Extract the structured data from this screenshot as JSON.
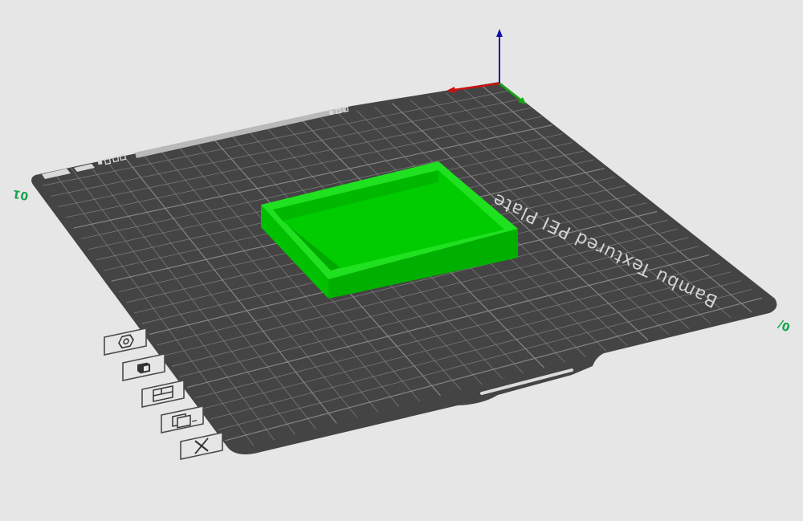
{
  "scene": {
    "background_color": "#e6e6e6",
    "plate": {
      "label": "Bambu Textured PEI Plate",
      "plate_number_left": "01",
      "plate_number_right": "0/",
      "plate_color": "#444444",
      "grid_color": "#8a8a8a",
      "label_color": "#d2d2d2"
    },
    "model": {
      "shape": "shallow-tray",
      "color": "#00cc00",
      "highlight_color": "#22e622",
      "shadow_color": "#00a000"
    },
    "axes": {
      "x_color": "#cc1111",
      "y_color": "#11aa11",
      "z_color": "#1111aa"
    }
  },
  "plate_toolbar": {
    "buttons": [
      {
        "id": "arrange",
        "icon": "hexagon-icon"
      },
      {
        "id": "orient",
        "icon": "lock-icon"
      },
      {
        "id": "layout",
        "icon": "layout-icon"
      },
      {
        "id": "settings",
        "icon": "edit-plate-icon"
      },
      {
        "id": "delete",
        "icon": "close-icon"
      }
    ]
  },
  "accent_color": "#00a651"
}
